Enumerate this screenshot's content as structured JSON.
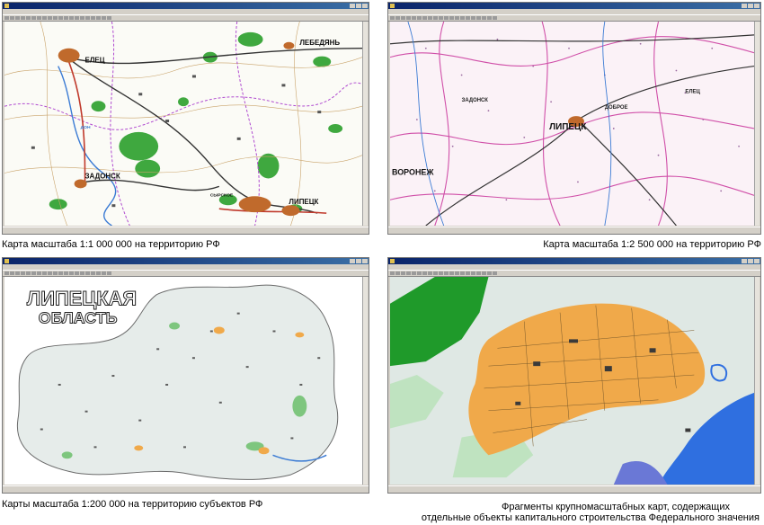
{
  "captions": {
    "top_left": "Карта масштаба 1:1 000 000 на территорию РФ",
    "top_right": "Карта масштаба 1:2 500 000 на территорию РФ",
    "bottom_left": "Карты масштаба 1:200 000 на территорию  субъектов РФ",
    "bottom_right_line1": "Фрагменты крупномасштабных  карт, содержащих",
    "bottom_right_line2": "отдельные объекты капитального строительства Федерального значения"
  },
  "windows": {
    "top_left": {
      "map_labels": [
        "ЛЕБЕДЯНЬ",
        "ЕЛЕЦ",
        "ЗАДОНСК",
        "ЛИПЕЦК",
        "ДОН",
        "СЫРСКОЕ"
      ]
    },
    "top_right": {
      "map_labels": [
        "ЛИПЕЦК",
        "ЗАДОНСК",
        "ДОБРОЕ",
        "ВОРОНЕЖ",
        "ЕЛЕЦ"
      ]
    },
    "bottom_left": {
      "map_labels": [
        "ЛИПЕЦКАЯ",
        "ОБЛАСТЬ"
      ]
    }
  },
  "colors": {
    "forest_green": "#3fa83f",
    "road_dark": "#333333",
    "river_blue": "#3b7bd4",
    "pink_admin": "#d04fa8",
    "urban_orange": "#f0a94a",
    "water_blue": "#2f6fe0",
    "window_chrome": "#d4d0c8",
    "title_blue": "#0a246a"
  }
}
